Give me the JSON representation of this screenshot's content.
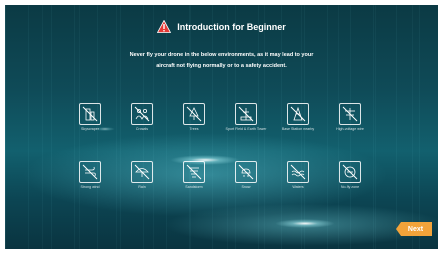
{
  "header": {
    "title": "Introduction for Beginner",
    "icon": "warning-triangle-icon",
    "icon_color": "#e53935"
  },
  "message": {
    "line1": "Never fly your drone in the below environments, as it may lead to your",
    "line2": "aircraft not flying normally or to a safety accident."
  },
  "environments": [
    {
      "label": "Skyscraper",
      "icon": "skyscraper-no-fly-icon"
    },
    {
      "label": "Crowds",
      "icon": "crowds-no-fly-icon"
    },
    {
      "label": "Trees",
      "icon": "trees-no-fly-icon"
    },
    {
      "label": "Sport Fleid & Earth Tower",
      "icon": "sport-field-no-fly-icon"
    },
    {
      "label": "Base Station nearby",
      "icon": "base-station-no-fly-icon"
    },
    {
      "label": "High-voltage wire",
      "icon": "high-voltage-no-fly-icon"
    },
    {
      "label": "Strong wind",
      "icon": "strong-wind-no-fly-icon"
    },
    {
      "label": "Rain",
      "icon": "rain-no-fly-icon"
    },
    {
      "label": "Sandstorm",
      "icon": "sandstorm-no-fly-icon"
    },
    {
      "label": "Snow",
      "icon": "snow-no-fly-icon"
    },
    {
      "label": "Waters",
      "icon": "waters-no-fly-icon"
    },
    {
      "label": "No-fly zone",
      "icon": "no-fly-zone-icon"
    }
  ],
  "footer": {
    "next_label": "Next",
    "accent": "#f2a33a"
  }
}
